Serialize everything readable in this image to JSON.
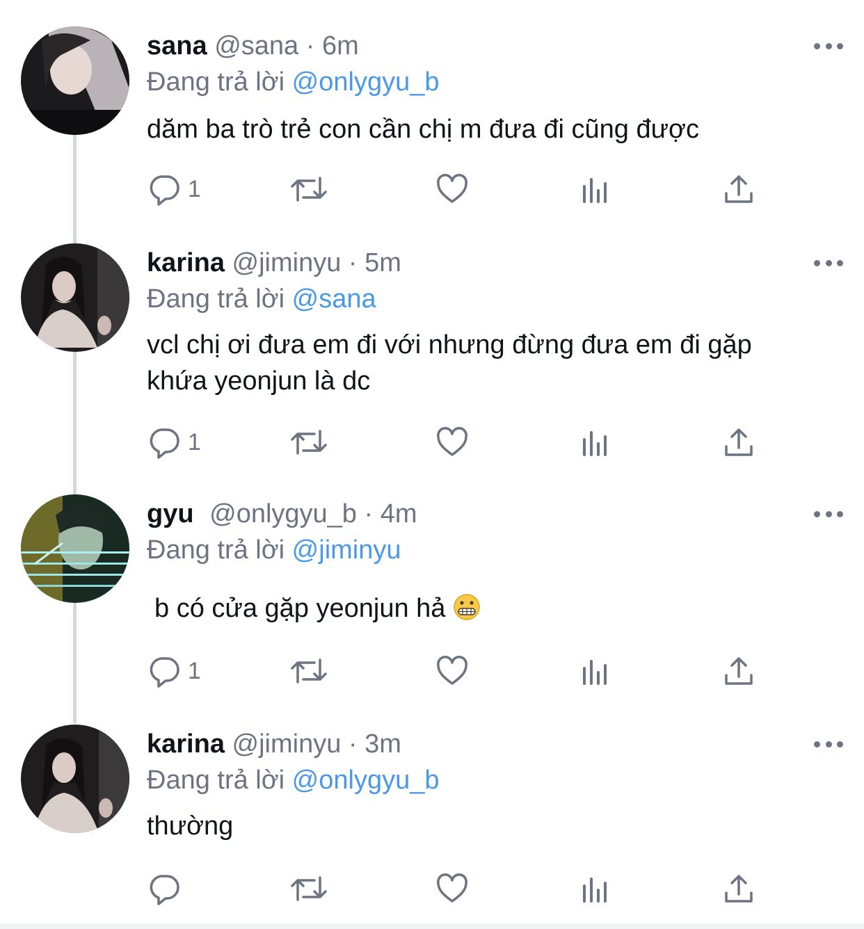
{
  "tweets": [
    {
      "name": "sana",
      "handle": "@sana",
      "time": "6m",
      "reply_prefix": "Đang trả lời",
      "reply_to": "@onlygyu_b",
      "text": "dăm ba trò trẻ con cần chị m đưa đi cũng được",
      "reply_count": "1"
    },
    {
      "name": "karina",
      "handle": "@jiminyu",
      "time": "5m",
      "reply_prefix": "Đang trả lời",
      "reply_to": "@sana",
      "text": "vcl chị ơi đưa em đi với nhưng đừng đưa em đi gặp khứa yeonjun là dc",
      "reply_count": "1"
    },
    {
      "name": "gyu",
      "handle": "@onlygyu_b",
      "time": "4m",
      "reply_prefix": "Đang trả lời",
      "reply_to": "@jiminyu",
      "text": "b có cửa gặp yeonjun hả",
      "emoji": "grimacing-face-emoji",
      "reply_count": "1"
    },
    {
      "name": "karina",
      "handle": "@jiminyu",
      "time": "3m",
      "reply_prefix": "Đang trả lời",
      "reply_to": "@onlygyu_b",
      "text": "thường",
      "reply_count": ""
    }
  ],
  "separator": "·",
  "icons": [
    "reply-icon",
    "retweet-icon",
    "like-icon",
    "analytics-icon",
    "share-icon",
    "more-icon"
  ],
  "colors": {
    "mention": "#4a99e9",
    "secondary_text": "#6b7480",
    "thread_line": "#cfd9de"
  }
}
